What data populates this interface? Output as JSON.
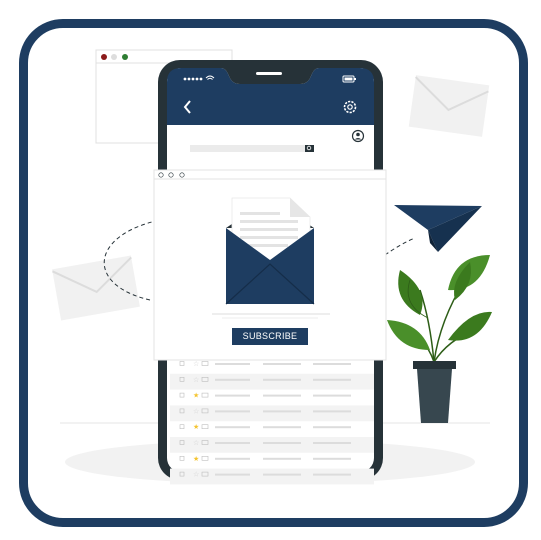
{
  "subscribe": {
    "label": "SUBSCRIBE"
  },
  "colors": {
    "navy": "#1e3d61",
    "phone_body": "#263238",
    "leaf_green": "#3b7a1e",
    "star_yellow": "#f4c430",
    "light_grey": "#ebebeb"
  },
  "icons": [
    "signal-dots-icon",
    "wifi-icon",
    "battery-icon",
    "back-arrow-icon",
    "gear-icon",
    "user-icon",
    "search-icon",
    "envelope-icon",
    "paper-plane-icon",
    "plant-icon",
    "star-icon"
  ],
  "inbox_rows": {
    "visible": 8,
    "starred_rows": [
      2,
      4,
      6
    ]
  }
}
